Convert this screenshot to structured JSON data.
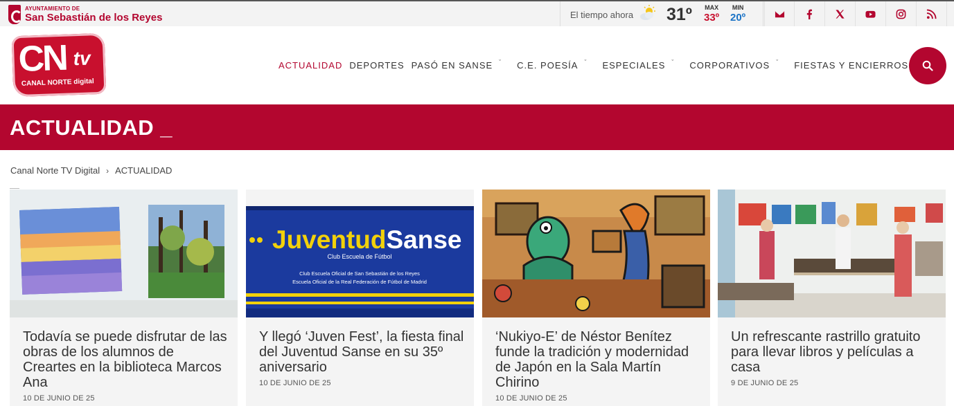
{
  "topbar": {
    "ayto_small": "AYUNTAMIENTO DE",
    "ayto_big": "San Sebastián de los Reyes",
    "weather_label": "El tiempo ahora",
    "weather_icon": "partly-sunny-icon",
    "temperature": "31º",
    "max_label": "MAX",
    "max_value": "33º",
    "min_label": "MIN",
    "min_value": "20º",
    "social": [
      "email-icon",
      "facebook-icon",
      "x-icon",
      "youtube-icon",
      "instagram-icon",
      "rss-icon"
    ]
  },
  "header": {
    "logo_main": "CN",
    "logo_tv": "tv",
    "logo_sub": "CANAL NORTE digital",
    "nav": [
      {
        "label": "ACTUALIDAD",
        "active": true,
        "dropdown": false
      },
      {
        "label": "DEPORTES",
        "active": false,
        "dropdown": false
      },
      {
        "label": "PASÓ EN SANSE",
        "active": false,
        "dropdown": true
      },
      {
        "label": "C.E. POESÍA",
        "active": false,
        "dropdown": true
      },
      {
        "label": "ESPECIALES",
        "active": false,
        "dropdown": true
      },
      {
        "label": "CORPORATIVOS",
        "active": false,
        "dropdown": true
      },
      {
        "label": "FIESTAS Y ENCIERROS",
        "active": false,
        "dropdown": true
      }
    ],
    "chevron": "ˇ",
    "search_icon": "search-icon"
  },
  "banner": {
    "title": "ACTUALIDAD _"
  },
  "breadcrumb": {
    "home": "Canal Norte TV Digital",
    "separator": "›",
    "current": "ACTUALIDAD"
  },
  "cards": [
    {
      "title": "Todavía se puede disfrutar de las obras de los alumnos de Creartes en la biblioteca Marcos Ana",
      "date": "10 DE JUNIO DE 25"
    },
    {
      "title": "Y llegó ‘Juven Fest’, la fiesta final del Juventud Sanse en su 35º aniversario",
      "date": "10 DE JUNIO DE 25"
    },
    {
      "title": "‘Nukiyo-E’ de Néstor Benítez funde la tradición y modernidad de Japón en la Sala Martín Chirino",
      "date": "10 DE JUNIO DE 25"
    },
    {
      "title": "Un refrescante rastrillo gratuito para llevar libros y películas a casa",
      "date": "9 DE JUNIO DE 25"
    }
  ],
  "card2_sign": {
    "brand_a": "Juventud",
    "brand_b": "Sanse",
    "sub": "Club Escuela de Fútbol",
    "line1": "Club Escuela Oficial de San Sebastián de los Reyes",
    "line2": "Escuela Oficial de la Real Federación de Fútbol de Madrid"
  },
  "colors": {
    "brand": "#b3062f",
    "max": "#c8102e",
    "min": "#1a73c6"
  }
}
